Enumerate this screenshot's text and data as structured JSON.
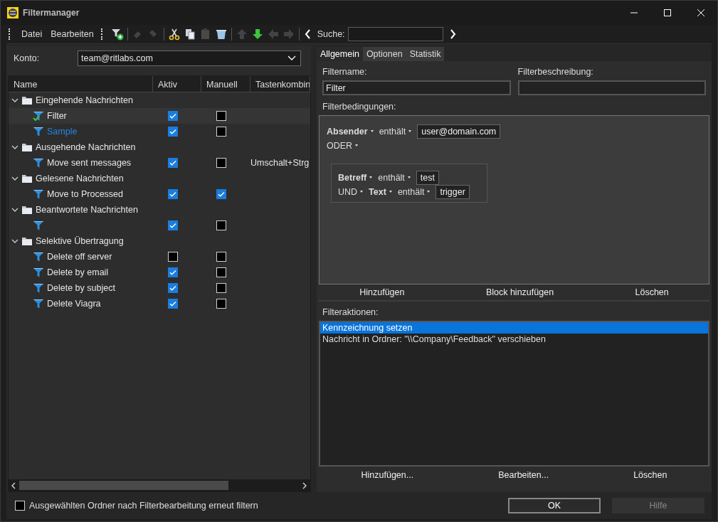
{
  "window": {
    "title": "Filtermanager"
  },
  "menu": [
    "Datei",
    "Bearbeiten"
  ],
  "toolbar": {
    "buttons": [
      {
        "disabled": false
      },
      {
        "disabled": true
      },
      {
        "disabled": true
      },
      {
        "disabled": false
      },
      {
        "disabled": false
      },
      {
        "disabled": true
      },
      {
        "disabled": false
      },
      {
        "disabled": true
      },
      {
        "disabled": false
      },
      {
        "disabled": true
      },
      {
        "disabled": true
      }
    ],
    "search_label": "Suche:"
  },
  "account": {
    "label": "Konto:",
    "value": "team@ritlabs.com"
  },
  "tree": {
    "columns": [
      "Name",
      "Aktiv",
      "Manuell",
      "Tastenkombin"
    ],
    "groups": [
      {
        "name": "Eingehende Nachrichten",
        "expanded": true,
        "children": [
          {
            "name": "Filter",
            "kind": "applied",
            "active": true,
            "manual": false,
            "selected": true
          },
          {
            "name": "Sample",
            "kind": "filter",
            "active": true,
            "manual": false,
            "selected": false,
            "emphasized": true
          }
        ]
      },
      {
        "name": "Ausgehende Nachrichten",
        "expanded": true,
        "children": [
          {
            "name": "Move sent messages",
            "kind": "filter",
            "active": true,
            "manual": false,
            "selected": false,
            "shortcut": "Umschalt+Strg"
          }
        ]
      },
      {
        "name": "Gelesene Nachrichten",
        "expanded": true,
        "children": [
          {
            "name": "Move to Processed",
            "kind": "filter",
            "active": true,
            "manual": true,
            "selected": false
          }
        ]
      },
      {
        "name": "Beantwortete Nachrichten",
        "expanded": true,
        "children": [
          {
            "kind": "filter",
            "active": true,
            "manual": false,
            "selected": false
          }
        ]
      },
      {
        "name": "Selektive Übertragung",
        "expanded": true,
        "children": [
          {
            "name": "Delete off server",
            "kind": "filter",
            "active": false,
            "manual": false,
            "selected": false
          },
          {
            "name": "Delete by email",
            "kind": "filter",
            "active": true,
            "manual": false,
            "selected": false
          },
          {
            "name": "Delete by subject",
            "kind": "filter",
            "active": true,
            "manual": false,
            "selected": false
          },
          {
            "name": "Delete Viagra",
            "kind": "filter",
            "active": true,
            "manual": false,
            "selected": false
          }
        ]
      }
    ]
  },
  "tabs": [
    {
      "label": "Allgemein",
      "selected": true
    },
    {
      "label": "Optionen",
      "selected": false
    },
    {
      "label": "Statistik",
      "selected": false
    }
  ],
  "filter": {
    "name_label": "Filtername:",
    "name": "Filter",
    "description_label": "Filterbeschreibung:",
    "conditions_label": "Filterbedingungen:",
    "conditions": {
      "rows": [
        [
          {
            "kind": "field",
            "text": "Absender"
          },
          {
            "kind": "operator",
            "text": "enthält"
          },
          {
            "kind": "value",
            "text": "user@domain.com"
          }
        ],
        [
          {
            "kind": "operator",
            "text": "ODER"
          }
        ]
      ],
      "block": {
        "rows": [
          [
            {
              "kind": "field",
              "text": "Betreff"
            },
            {
              "kind": "operator",
              "text": "enthält"
            },
            {
              "kind": "value",
              "text": "test"
            }
          ],
          [
            {
              "kind": "operator",
              "text": "UND"
            },
            {
              "kind": "field",
              "text": "Text"
            },
            {
              "kind": "operator",
              "text": "enthält"
            },
            {
              "kind": "value",
              "text": "trigger"
            }
          ]
        ]
      }
    },
    "condition_buttons": [
      "Hinzufügen",
      "Block hinzufügen",
      "Löschen"
    ],
    "actions_label": "Filteraktionen:",
    "actions": [
      {
        "text": "Kennzeichnung setzen",
        "selected": true
      },
      {
        "text": "Nachricht in Ordner: \"\\\\Company\\Feedback\" verschieben",
        "selected": false
      }
    ],
    "action_buttons": [
      "Hinzufügen...",
      "Bearbeiten...",
      "Löschen"
    ]
  },
  "footer": {
    "refilter": {
      "label": "Ausgewählten Ordner nach Filterbearbeitung erneut filtern",
      "checked": false
    },
    "buttons": [
      {
        "label": "OK",
        "default": true
      },
      {
        "label": "Hilfe",
        "default": false
      }
    ]
  }
}
